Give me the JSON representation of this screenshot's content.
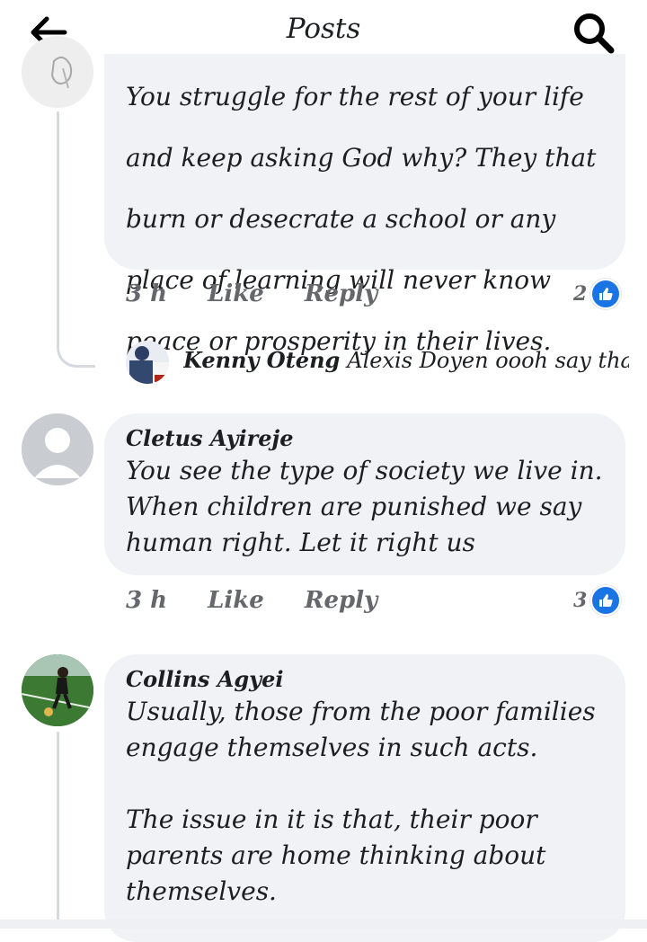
{
  "header": {
    "title": "Posts",
    "back_icon": "arrow-left-icon",
    "search_icon": "search-icon"
  },
  "comments": [
    {
      "author": "",
      "text_lines": [
        "You struggle for the rest of your life",
        "and keep asking God why? They that",
        "burn or desecrate a school or any",
        "place of learning will never know",
        "peace or prosperity in their lives."
      ],
      "time": "3 h",
      "like_label": "Like",
      "reply_label": "Reply",
      "reaction_count": "2"
    },
    {
      "author": "Cletus Ayireje",
      "text_lines": [
        "You see the type of society we live in.",
        "When children are punished we say",
        "human right. Let it right us"
      ],
      "time": "3 h",
      "like_label": "Like",
      "reply_label": "Reply",
      "reaction_count": "3"
    },
    {
      "author": "Collins Agyei",
      "text_lines": [
        "Usually, those from the poor families",
        "engage themselves in such acts.",
        "",
        "The issue in it is that, their poor",
        "parents are home thinking about",
        "themselves."
      ]
    }
  ],
  "reply_preview": {
    "author": "Kenny Oteng",
    "text": "Alexis Doyen oooh say tha..."
  },
  "colors": {
    "bubble": "#f0f2f5",
    "like_blue": "#1b74e4",
    "meta_gray": "#65676b",
    "thread_line": "#d6d9de"
  }
}
